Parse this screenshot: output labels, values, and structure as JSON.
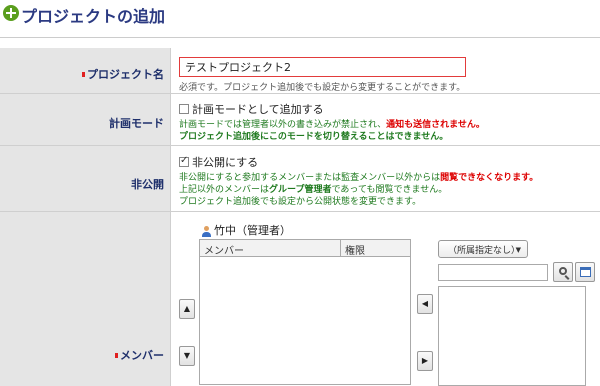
{
  "page": {
    "title": "プロジェクトの追加"
  },
  "form": {
    "project_name": {
      "label": "プロジェクト名",
      "value": "テストプロジェクト2",
      "hint": "必須です。プロジェクト追加後でも設定から変更することができます。"
    },
    "plan_mode": {
      "label": "計画モード",
      "checkbox_label": "計画モードとして追加する",
      "checked": false,
      "note1_prefix": "計画モードでは管理者以外の書き込みが禁止され、",
      "note1_emphasis": "通知も送信されません。",
      "note2": "プロジェクト追加後にこのモードを切り替えることはできません。"
    },
    "private": {
      "label": "非公開",
      "checkbox_label": "非公開にする",
      "checked": true,
      "note1_prefix": "非公開にすると参加するメンバーまたは監査メンバー以外からは",
      "note1_emphasis": "閲覧できなくなります。",
      "note2_prefix": "上記以外のメンバーは",
      "note2_bold": "グループ管理者",
      "note2_suffix": "であっても閲覧できません。",
      "note3": "プロジェクト追加後でも設定から公開状態を変更できます。"
    },
    "members": {
      "label": "メンバー",
      "owner": "竹中（管理者）",
      "col_member": "メンバー",
      "col_role": "権限",
      "group_select": "（所属指定なし）",
      "icons": {
        "owner": "user-icon",
        "up": "arrow-up-icon",
        "down": "arrow-down-icon",
        "left": "arrow-left-icon",
        "right": "arrow-right-icon",
        "search": "search-icon",
        "address_book": "address-book-icon"
      },
      "arrows": {
        "up": "▲",
        "down": "▼",
        "left": "◀",
        "right": "▶"
      }
    }
  },
  "colors": {
    "title": "#2b3a82",
    "label_bg": "#e5e5e5",
    "label_text": "#1e2f6b",
    "required": "#e02020",
    "note_green": "#1f7a1f",
    "warning_red": "#dd0000",
    "input_border_error": "#e23b3b"
  }
}
